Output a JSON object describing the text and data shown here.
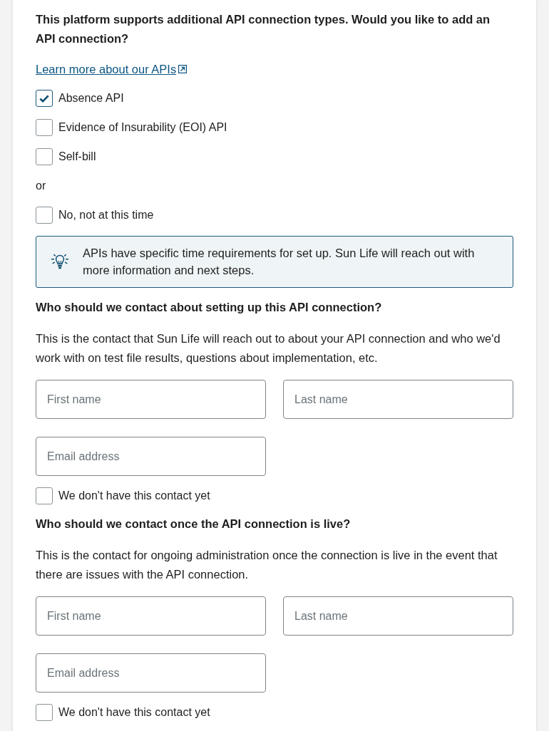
{
  "question": {
    "text": "This platform supports additional API connection types. Would you like to add an API connection?",
    "link": "Learn more about our APIs"
  },
  "api_options": [
    {
      "label": "Absence API",
      "checked": true
    },
    {
      "label": "Evidence of Insurability (EOI) API",
      "checked": false
    },
    {
      "label": "Self-bill",
      "checked": false
    }
  ],
  "separator": "or",
  "decline_option": {
    "label": "No, not at this time",
    "checked": false
  },
  "info_note": {
    "text": "APIs have specific time requirements for set up. Sun Life will reach out with more information and next steps."
  },
  "contact_sections": [
    {
      "heading": "Who should we contact about setting up this API connection?",
      "description": "This is the contact that Sun Life will reach out to about your API connection and who we'd work with on test file results, questions about implementation, etc.",
      "fields": [
        {
          "placeholder": "First name"
        },
        {
          "placeholder": "Last name"
        },
        {
          "placeholder": "Email address"
        }
      ],
      "no_contact": {
        "label": "We don't have this contact yet",
        "checked": false
      }
    },
    {
      "heading": "Who should we contact once the API connection is live?",
      "description": "This is the contact for ongoing administration once the connection is live in the event that there are issues with the API connection.",
      "fields": [
        {
          "placeholder": "First name"
        },
        {
          "placeholder": "Last name"
        },
        {
          "placeholder": "Email address"
        }
      ],
      "no_contact": {
        "label": "We don't have this contact yet",
        "checked": false
      }
    }
  ]
}
